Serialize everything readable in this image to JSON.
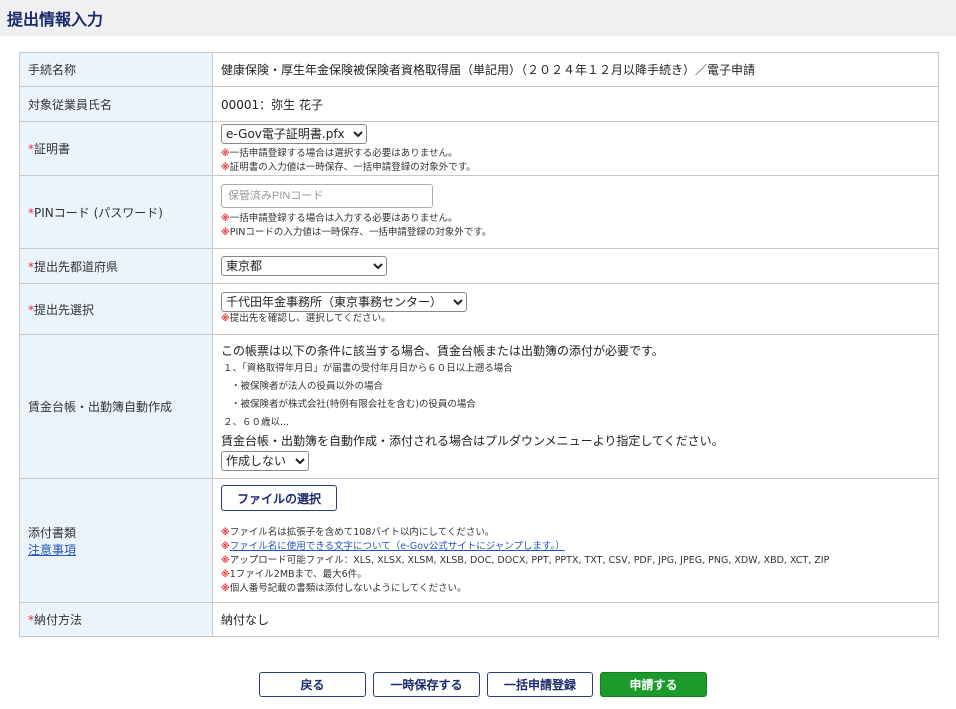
{
  "header": {
    "title": "提出情報入力"
  },
  "rows": {
    "procedure": {
      "label": "手続名称",
      "value": "健康保険・厚生年金保険被保険者資格取得届（単記用）（２０２４年１２月以降手続き）／電子申請"
    },
    "employee": {
      "label": "対象従業員氏名",
      "value": "00001：弥生 花子"
    },
    "certificate": {
      "req": "*",
      "label": "証明書",
      "selected": "e-Gov電子証明書.pfx",
      "note_mark": "※",
      "notes": [
        "一括申請登録する場合は選択する必要はありません。",
        "証明書の入力値は一時保存、一括申請登録の対象外です。"
      ]
    },
    "pin": {
      "req": "*",
      "label": "PINコード (パスワード)",
      "placeholder": "保管済みPINコード",
      "notes": [
        "一括申請登録する場合は入力する必要はありません。",
        "PINコードの入力値は一時保存、一括申請登録の対象外です。"
      ]
    },
    "prefecture": {
      "req": "*",
      "label": "提出先都道府県",
      "selected": "東京都"
    },
    "destination": {
      "req": "*",
      "label": "提出先選択",
      "selected": "千代田年金事務所（東京事務センター）",
      "notes": [
        "提出先を確認し、選択してください。"
      ]
    },
    "wage": {
      "label": "賃金台帳・出勤簿自動作成",
      "intro": "この帳票は以下の条件に該当する場合、賃金台帳または出勤簿の添付が必要です。",
      "cond1": "１、「資格取得年月日」が届書の受付年月日から６０日以上遡る場合",
      "cond1a": "・被保険者が法人の役員以外の場合",
      "cond1b": "・被保険者が株式会社(特例有限会社を含む)の役員の場合",
      "cond2": "２、６０歳以...",
      "instruction": "賃金台帳・出勤簿を自動作成・添付される場合はプルダウンメニューより指定してください。",
      "selected": "作成しない"
    },
    "attachment": {
      "label": "添付書類",
      "link": "注意事項",
      "button": "ファイルの選択",
      "notes": [
        "ファイル名は拡張子を含めて108バイト以内にしてください。",
        "ファイル名に使用できる文字について（e-Gov公式サイトにジャンプします。）",
        "アップロード可能ファイル：XLS, XLSX, XLSM, XLSB, DOC, DOCX, PPT, PPTX, TXT, CSV, PDF, JPG, JPEG, PNG, XDW, XBD, XCT, ZIP",
        "1ファイル2MBまで、最大6件。",
        "個人番号記載の書類は添付しないようにしてください。"
      ]
    },
    "payment": {
      "req": "*",
      "label": "納付方法",
      "value": "納付なし"
    }
  },
  "buttons": {
    "back": "戻る",
    "save": "一時保存する",
    "batch": "一括申請登録",
    "apply": "申請する"
  },
  "colors": {
    "accent": "#1c9b2c",
    "required": "#e03030",
    "label_bg": "#ebf3fb",
    "title": "#1a2a6c"
  }
}
